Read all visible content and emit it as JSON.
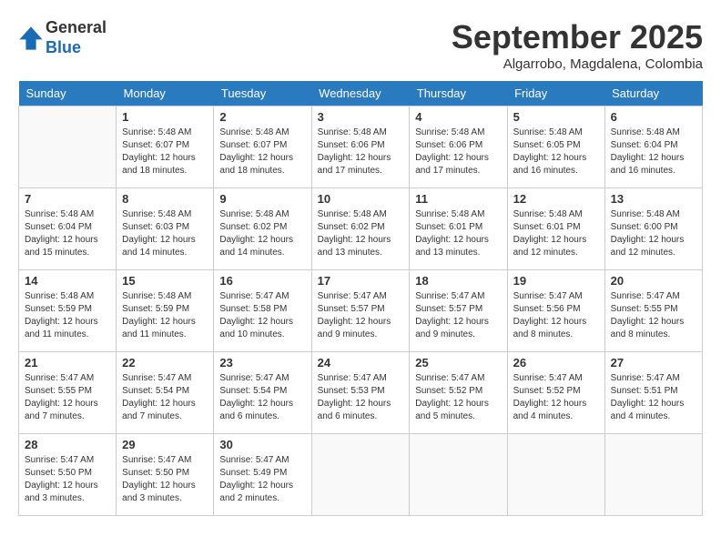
{
  "header": {
    "logo_line1": "General",
    "logo_line2": "Blue",
    "month": "September 2025",
    "location": "Algarrobo, Magdalena, Colombia"
  },
  "weekdays": [
    "Sunday",
    "Monday",
    "Tuesday",
    "Wednesday",
    "Thursday",
    "Friday",
    "Saturday"
  ],
  "weeks": [
    [
      {
        "day": "",
        "info": ""
      },
      {
        "day": "1",
        "info": "Sunrise: 5:48 AM\nSunset: 6:07 PM\nDaylight: 12 hours\nand 18 minutes."
      },
      {
        "day": "2",
        "info": "Sunrise: 5:48 AM\nSunset: 6:07 PM\nDaylight: 12 hours\nand 18 minutes."
      },
      {
        "day": "3",
        "info": "Sunrise: 5:48 AM\nSunset: 6:06 PM\nDaylight: 12 hours\nand 17 minutes."
      },
      {
        "day": "4",
        "info": "Sunrise: 5:48 AM\nSunset: 6:06 PM\nDaylight: 12 hours\nand 17 minutes."
      },
      {
        "day": "5",
        "info": "Sunrise: 5:48 AM\nSunset: 6:05 PM\nDaylight: 12 hours\nand 16 minutes."
      },
      {
        "day": "6",
        "info": "Sunrise: 5:48 AM\nSunset: 6:04 PM\nDaylight: 12 hours\nand 16 minutes."
      }
    ],
    [
      {
        "day": "7",
        "info": "Sunrise: 5:48 AM\nSunset: 6:04 PM\nDaylight: 12 hours\nand 15 minutes."
      },
      {
        "day": "8",
        "info": "Sunrise: 5:48 AM\nSunset: 6:03 PM\nDaylight: 12 hours\nand 14 minutes."
      },
      {
        "day": "9",
        "info": "Sunrise: 5:48 AM\nSunset: 6:02 PM\nDaylight: 12 hours\nand 14 minutes."
      },
      {
        "day": "10",
        "info": "Sunrise: 5:48 AM\nSunset: 6:02 PM\nDaylight: 12 hours\nand 13 minutes."
      },
      {
        "day": "11",
        "info": "Sunrise: 5:48 AM\nSunset: 6:01 PM\nDaylight: 12 hours\nand 13 minutes."
      },
      {
        "day": "12",
        "info": "Sunrise: 5:48 AM\nSunset: 6:01 PM\nDaylight: 12 hours\nand 12 minutes."
      },
      {
        "day": "13",
        "info": "Sunrise: 5:48 AM\nSunset: 6:00 PM\nDaylight: 12 hours\nand 12 minutes."
      }
    ],
    [
      {
        "day": "14",
        "info": "Sunrise: 5:48 AM\nSunset: 5:59 PM\nDaylight: 12 hours\nand 11 minutes."
      },
      {
        "day": "15",
        "info": "Sunrise: 5:48 AM\nSunset: 5:59 PM\nDaylight: 12 hours\nand 11 minutes."
      },
      {
        "day": "16",
        "info": "Sunrise: 5:47 AM\nSunset: 5:58 PM\nDaylight: 12 hours\nand 10 minutes."
      },
      {
        "day": "17",
        "info": "Sunrise: 5:47 AM\nSunset: 5:57 PM\nDaylight: 12 hours\nand 9 minutes."
      },
      {
        "day": "18",
        "info": "Sunrise: 5:47 AM\nSunset: 5:57 PM\nDaylight: 12 hours\nand 9 minutes."
      },
      {
        "day": "19",
        "info": "Sunrise: 5:47 AM\nSunset: 5:56 PM\nDaylight: 12 hours\nand 8 minutes."
      },
      {
        "day": "20",
        "info": "Sunrise: 5:47 AM\nSunset: 5:55 PM\nDaylight: 12 hours\nand 8 minutes."
      }
    ],
    [
      {
        "day": "21",
        "info": "Sunrise: 5:47 AM\nSunset: 5:55 PM\nDaylight: 12 hours\nand 7 minutes."
      },
      {
        "day": "22",
        "info": "Sunrise: 5:47 AM\nSunset: 5:54 PM\nDaylight: 12 hours\nand 7 minutes."
      },
      {
        "day": "23",
        "info": "Sunrise: 5:47 AM\nSunset: 5:54 PM\nDaylight: 12 hours\nand 6 minutes."
      },
      {
        "day": "24",
        "info": "Sunrise: 5:47 AM\nSunset: 5:53 PM\nDaylight: 12 hours\nand 6 minutes."
      },
      {
        "day": "25",
        "info": "Sunrise: 5:47 AM\nSunset: 5:52 PM\nDaylight: 12 hours\nand 5 minutes."
      },
      {
        "day": "26",
        "info": "Sunrise: 5:47 AM\nSunset: 5:52 PM\nDaylight: 12 hours\nand 4 minutes."
      },
      {
        "day": "27",
        "info": "Sunrise: 5:47 AM\nSunset: 5:51 PM\nDaylight: 12 hours\nand 4 minutes."
      }
    ],
    [
      {
        "day": "28",
        "info": "Sunrise: 5:47 AM\nSunset: 5:50 PM\nDaylight: 12 hours\nand 3 minutes."
      },
      {
        "day": "29",
        "info": "Sunrise: 5:47 AM\nSunset: 5:50 PM\nDaylight: 12 hours\nand 3 minutes."
      },
      {
        "day": "30",
        "info": "Sunrise: 5:47 AM\nSunset: 5:49 PM\nDaylight: 12 hours\nand 2 minutes."
      },
      {
        "day": "",
        "info": ""
      },
      {
        "day": "",
        "info": ""
      },
      {
        "day": "",
        "info": ""
      },
      {
        "day": "",
        "info": ""
      }
    ]
  ]
}
